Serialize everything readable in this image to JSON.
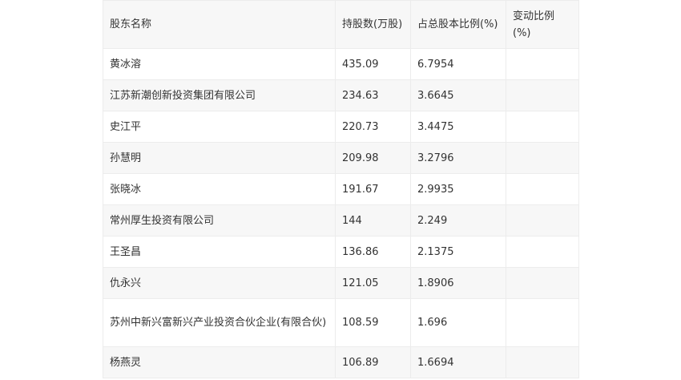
{
  "table": {
    "headers": [
      "股东名称",
      "持股数(万股)",
      "占总股本比例(%)",
      "变动比例(%)"
    ],
    "rows": [
      [
        "黄冰溶",
        "435.09",
        "6.7954",
        ""
      ],
      [
        "江苏新潮创新投资集团有限公司",
        "234.63",
        "3.6645",
        ""
      ],
      [
        "史江平",
        "220.73",
        "3.4475",
        ""
      ],
      [
        "孙慧明",
        "209.98",
        "3.2796",
        ""
      ],
      [
        "张晓冰",
        "191.67",
        "2.9935",
        ""
      ],
      [
        "常州厚生投资有限公司",
        "144",
        "2.249",
        ""
      ],
      [
        "王圣昌",
        "136.86",
        "2.1375",
        ""
      ],
      [
        "仇永兴",
        "121.05",
        "1.8906",
        ""
      ],
      [
        "苏州中新兴富新兴产业投资合伙企业(有限合伙)",
        "108.59",
        "1.696",
        ""
      ],
      [
        "杨燕灵",
        "106.89",
        "1.6694",
        ""
      ]
    ]
  }
}
